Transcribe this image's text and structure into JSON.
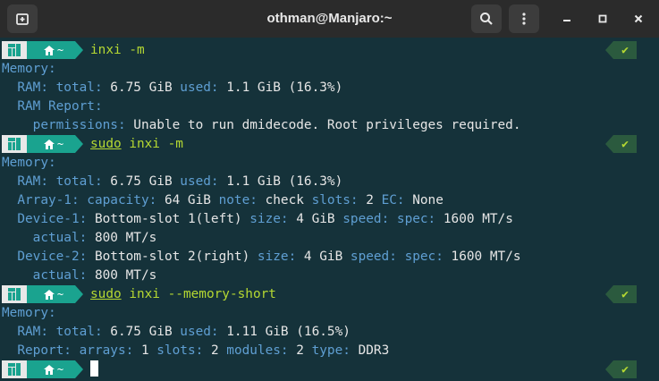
{
  "window": {
    "title": "othman@Manjaro:~",
    "new_tab_icon": "new-tab-icon",
    "search_icon": "search-icon",
    "menu_icon": "kebab-menu-icon"
  },
  "prompt": {
    "home": "~",
    "status": "✔"
  },
  "blocks": [
    {
      "cmd_sudo": "",
      "cmd": "inxi -m",
      "output": [
        {
          "indent": "",
          "parts": [
            {
              "k": "Memory:"
            }
          ]
        },
        {
          "indent": "  ",
          "parts": [
            {
              "k": "RAM: total:"
            },
            {
              "v": " 6.75 GiB "
            },
            {
              "k": "used:"
            },
            {
              "v": " 1.1 GiB (16.3%)"
            }
          ]
        },
        {
          "indent": "  ",
          "parts": [
            {
              "k": "RAM Report:"
            }
          ]
        },
        {
          "indent": "    ",
          "parts": [
            {
              "k": "permissions:"
            },
            {
              "v": " Unable to run dmidecode. Root privileges required."
            }
          ]
        }
      ]
    },
    {
      "cmd_sudo": "sudo",
      "cmd": " inxi -m",
      "output": [
        {
          "indent": "",
          "parts": [
            {
              "k": "Memory:"
            }
          ]
        },
        {
          "indent": "  ",
          "parts": [
            {
              "k": "RAM: total:"
            },
            {
              "v": " 6.75 GiB "
            },
            {
              "k": "used:"
            },
            {
              "v": " 1.1 GiB (16.3%)"
            }
          ]
        },
        {
          "indent": "  ",
          "parts": [
            {
              "k": "Array-1: capacity:"
            },
            {
              "v": " 64 GiB "
            },
            {
              "k": "note:"
            },
            {
              "v": " check "
            },
            {
              "k": "slots:"
            },
            {
              "v": " 2 "
            },
            {
              "k": "EC:"
            },
            {
              "v": " None"
            }
          ]
        },
        {
          "indent": "  ",
          "parts": [
            {
              "k": "Device-1:"
            },
            {
              "v": " Bottom-slot 1(left) "
            },
            {
              "k": "size:"
            },
            {
              "v": " 4 GiB "
            },
            {
              "k": "speed:"
            },
            {
              "v": " "
            },
            {
              "k": "spec:"
            },
            {
              "v": " 1600 MT/s"
            }
          ]
        },
        {
          "indent": "    ",
          "parts": [
            {
              "k": "actual:"
            },
            {
              "v": " 800 MT/s"
            }
          ]
        },
        {
          "indent": "  ",
          "parts": [
            {
              "k": "Device-2:"
            },
            {
              "v": " Bottom-slot 2(right) "
            },
            {
              "k": "size:"
            },
            {
              "v": " 4 GiB "
            },
            {
              "k": "speed:"
            },
            {
              "v": " "
            },
            {
              "k": "spec:"
            },
            {
              "v": " 1600 MT/s"
            }
          ]
        },
        {
          "indent": "    ",
          "parts": [
            {
              "k": "actual:"
            },
            {
              "v": " 800 MT/s"
            }
          ]
        }
      ]
    },
    {
      "cmd_sudo": "sudo",
      "cmd": " inxi --memory-short",
      "output": [
        {
          "indent": "",
          "parts": [
            {
              "k": "Memory:"
            }
          ]
        },
        {
          "indent": "  ",
          "parts": [
            {
              "k": "RAM: total:"
            },
            {
              "v": " 6.75 GiB "
            },
            {
              "k": "used:"
            },
            {
              "v": " 1.11 GiB (16.5%)"
            }
          ]
        },
        {
          "indent": "  ",
          "parts": [
            {
              "k": "Report: arrays:"
            },
            {
              "v": " 1 "
            },
            {
              "k": "slots:"
            },
            {
              "v": " 2 "
            },
            {
              "k": "modules:"
            },
            {
              "v": " 2 "
            },
            {
              "k": "type:"
            },
            {
              "v": " DDR3"
            }
          ]
        }
      ]
    },
    {
      "cmd_sudo": "",
      "cmd": "",
      "output": []
    }
  ]
}
